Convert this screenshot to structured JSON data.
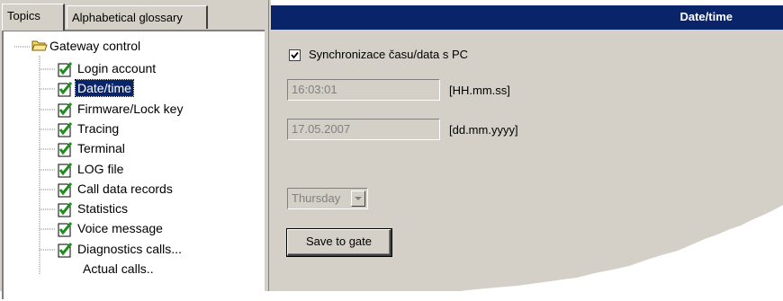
{
  "tabs": [
    {
      "label": "Topics"
    },
    {
      "label": "Alphabetical glossary"
    }
  ],
  "tree": {
    "root": {
      "label": "Gateway control",
      "icon": "folder-open-icon"
    },
    "items": [
      {
        "label": "Login account",
        "icon": "checked-doc-icon"
      },
      {
        "label": "Date/time",
        "icon": "checked-doc-icon",
        "selected": true
      },
      {
        "label": "Firmware/Lock key",
        "icon": "checked-doc-icon"
      },
      {
        "label": "Tracing",
        "icon": "checked-doc-icon"
      },
      {
        "label": "Terminal",
        "icon": "checked-doc-icon"
      },
      {
        "label": "LOG file",
        "icon": "checked-doc-icon"
      },
      {
        "label": "Call data records",
        "icon": "checked-doc-icon"
      },
      {
        "label": "Statistics",
        "icon": "checked-doc-icon"
      },
      {
        "label": "Voice message",
        "icon": "checked-doc-icon"
      },
      {
        "label": "Diagnostics calls...",
        "icon": "checked-doc-icon"
      },
      {
        "label": "Actual calls..",
        "icon": ""
      }
    ]
  },
  "panel": {
    "title": "Date/time",
    "sync_label": "Synchronizace času/data s PC",
    "sync_checked": true,
    "time_value": "16:03:01",
    "time_format": "[HH.mm.ss]",
    "date_value": "17.05.2007",
    "date_format": "[dd.mm.yyyy]",
    "day_value": "Thursday",
    "save_label": "Save to gate"
  },
  "colors": {
    "title_bar": "#0a246a",
    "face": "#d4d0c8",
    "check_green": "#1e8f1e"
  }
}
